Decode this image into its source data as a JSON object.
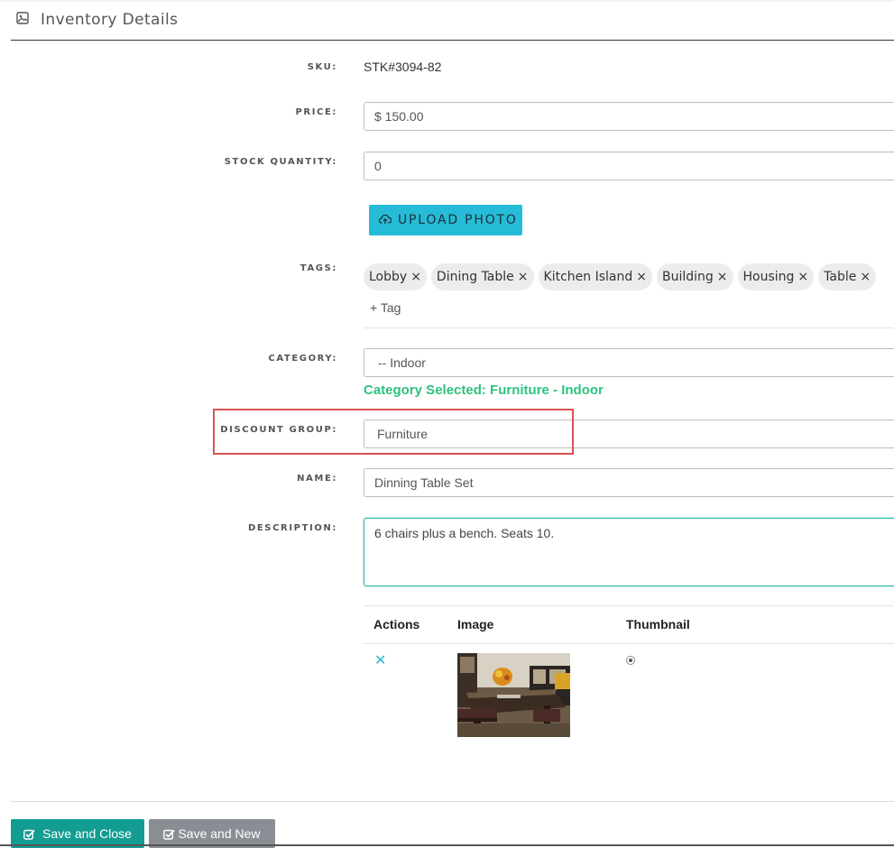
{
  "header": {
    "title": "Inventory Details",
    "icon": "image-icon"
  },
  "form": {
    "sku": {
      "label": "SKU:",
      "value": "STK#3094-82"
    },
    "price": {
      "label": "PRICE:",
      "value": "$ 150.00"
    },
    "stock_quantity": {
      "label": "STOCK QUANTITY:",
      "value": "0"
    },
    "upload_photo": {
      "label": "UPLOAD PHOTO",
      "icon": "cloud-upload-icon"
    },
    "tags": {
      "label": "TAGS:",
      "items": [
        "Lobby",
        "Dining Table",
        "Kitchen Island",
        "Building",
        "Housing",
        "Table"
      ],
      "remove_glyph": "×",
      "add_label": "+ Tag"
    },
    "category": {
      "label": "CATEGORY:",
      "value": "-- Indoor",
      "selected_text": "Category Selected: Furniture - Indoor"
    },
    "discount_group": {
      "label": "DISCOUNT GROUP:",
      "value": "Furniture",
      "highlight_color": "#d9534f"
    },
    "name": {
      "label": "NAME:",
      "value": "Dinning Table Set"
    },
    "description": {
      "label": "DESCRIPTION:",
      "value": "6 chairs plus a bench.  Seats 10."
    }
  },
  "photos_table": {
    "columns": [
      "Actions",
      "Image",
      "Thumbnail"
    ],
    "rows": [
      {
        "action_icon": "close-icon",
        "action_glyph": "✕",
        "thumbnail_selected": true
      }
    ]
  },
  "footer": {
    "save_close_label": "Save and Close",
    "save_new_label": "Save and New",
    "accent_color": "#139c91",
    "secondary_color": "#8a8e94"
  }
}
